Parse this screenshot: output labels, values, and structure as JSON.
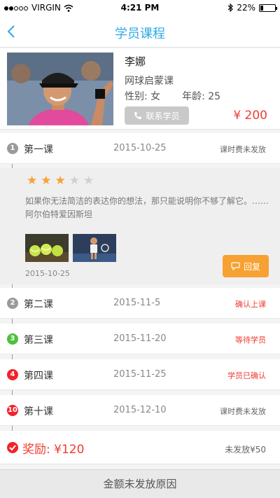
{
  "status_bar": {
    "carrier": "VIRGIN",
    "time": "4:21 PM",
    "battery": "22%",
    "battery_level": 0.22
  },
  "nav": {
    "title": "学员课程",
    "back_icon": "chevron-left-icon"
  },
  "student": {
    "name": "李娜",
    "course": "网球启蒙课",
    "gender_label": "性别:",
    "gender": "女",
    "age_label": "年龄:",
    "age": "25",
    "contact_label": "联系学员",
    "price": "¥ 200"
  },
  "lessons": [
    {
      "number": "1",
      "name": "第一课",
      "date": "2015-10-25",
      "status": "课时费未发放",
      "color": "#9a9a9a",
      "status_color": "#666666"
    },
    {
      "number": "2",
      "name": "第二课",
      "date": "2015-11-5",
      "status": "确认上课",
      "color": "#9a9a9a",
      "status_color": "#f03c32"
    },
    {
      "number": "3",
      "name": "第三课",
      "date": "2015-11-20",
      "status": "等待学员",
      "color": "#4cc23a",
      "status_color": "#f03c32"
    },
    {
      "number": "4",
      "name": "第四课",
      "date": "2015-11-25",
      "status": "学员已确认",
      "color": "#f2232a",
      "status_color": "#f03c32"
    },
    {
      "number": "10",
      "name": "第十课",
      "date": "2015-12-10",
      "status": "课时费未发放",
      "color": "#f2232a",
      "status_color": "#666666"
    }
  ],
  "review": {
    "rating": 3,
    "max_rating": 5,
    "text": "如果你无法简洁的表达你的想法，那只能说明你不够了解它。……阿尔伯特爱因斯坦",
    "date": "2015-10-25",
    "reply_label": "回复"
  },
  "reward": {
    "label": "奖励: ¥120",
    "status": "未发放¥50"
  },
  "bottom_button": "金额未发放原因",
  "colors": {
    "accent": "#2fa9e6",
    "red": "#f03c32",
    "orange": "#f7a133",
    "green": "#4cc23a"
  }
}
